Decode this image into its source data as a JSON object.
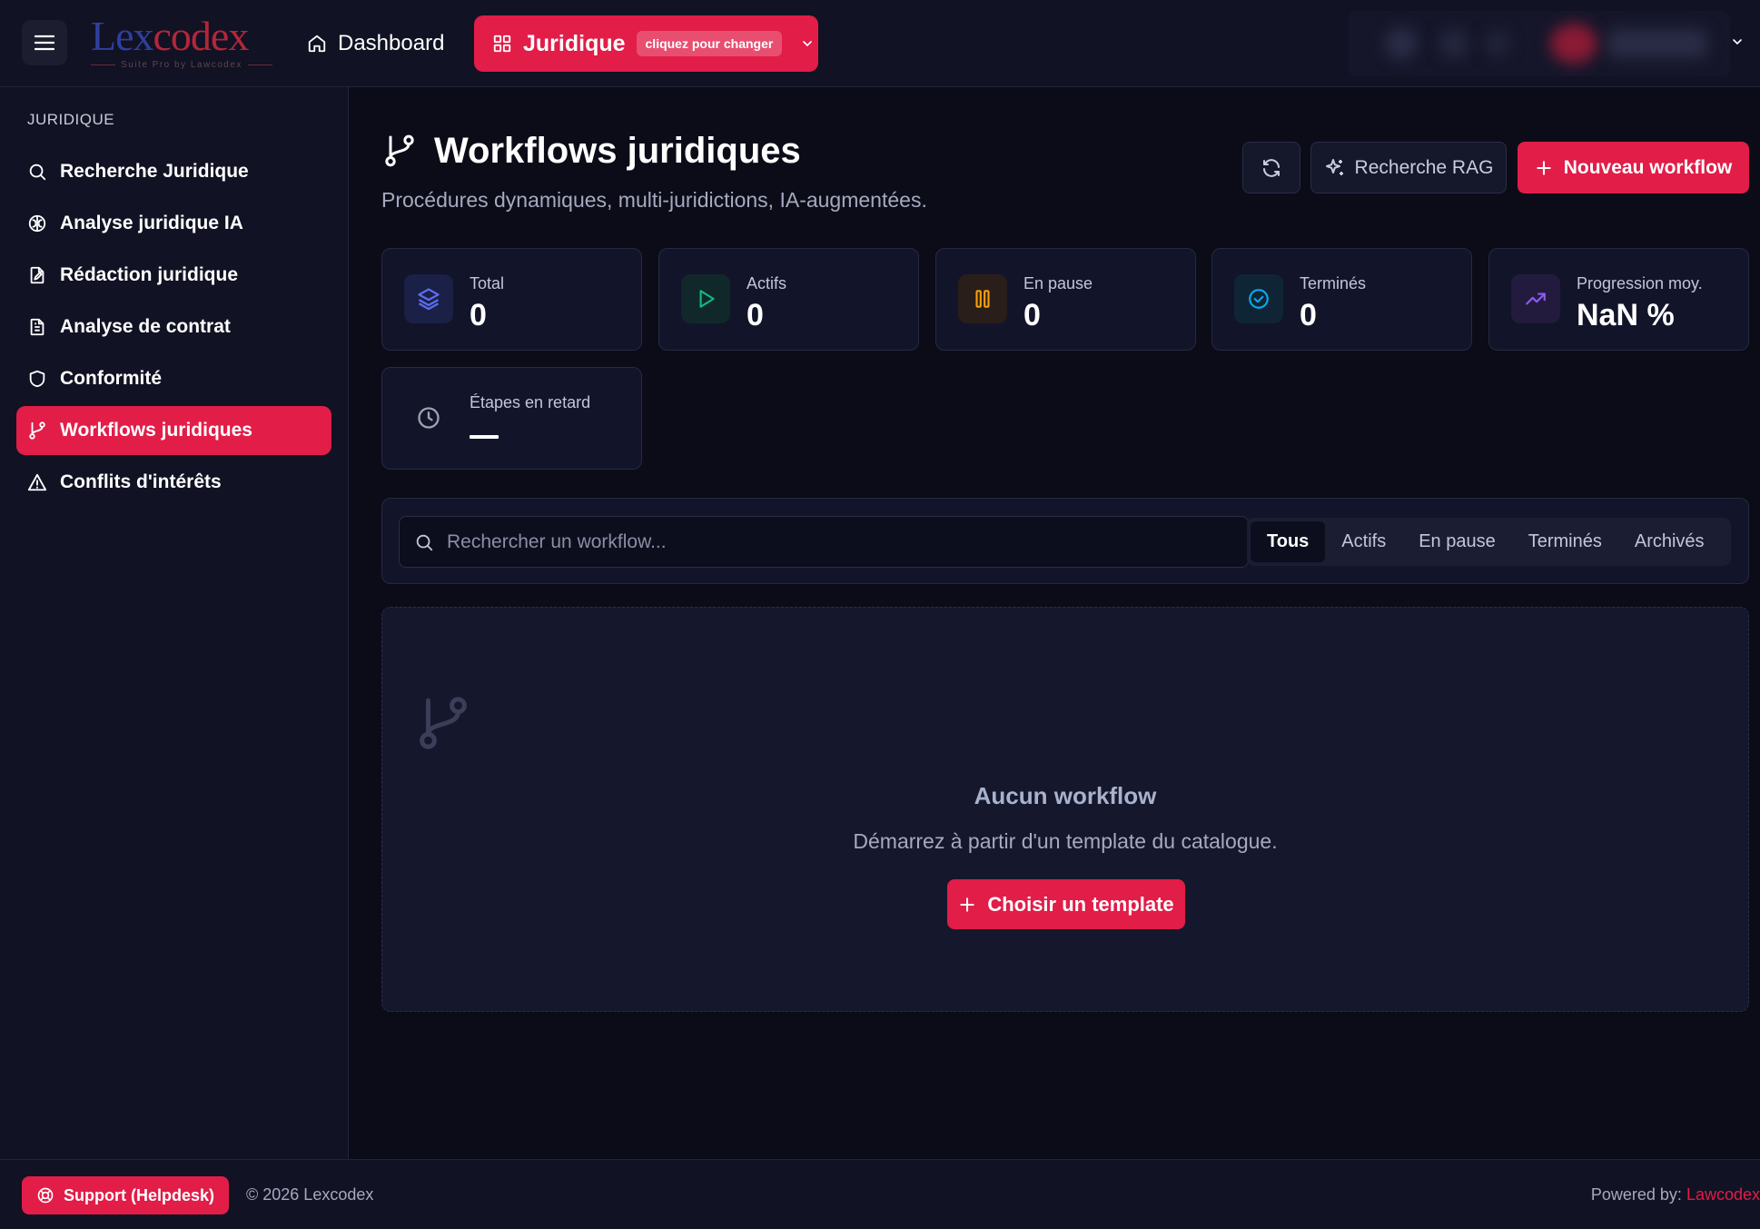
{
  "header": {
    "logo": {
      "part1": "Lex",
      "part2": "codex",
      "subtitle": "Suite Pro by Lawcodex"
    },
    "dashboard_label": "Dashboard",
    "module": {
      "name": "Juridique",
      "hint": "cliquez pour changer"
    }
  },
  "sidebar": {
    "section_title": "JURIDIQUE",
    "items": [
      {
        "label": "Recherche Juridique",
        "icon": "search-icon"
      },
      {
        "label": "Analyse juridique IA",
        "icon": "brain-icon"
      },
      {
        "label": "Rédaction juridique",
        "icon": "file-pen-icon"
      },
      {
        "label": "Analyse de contrat",
        "icon": "file-text-icon"
      },
      {
        "label": "Conformité",
        "icon": "shield-icon"
      },
      {
        "label": "Workflows juridiques",
        "icon": "git-branch-icon",
        "active": true
      },
      {
        "label": "Conflits d'intérêts",
        "icon": "alert-triangle-icon"
      }
    ]
  },
  "page": {
    "title": "Workflows juridiques",
    "subtitle": "Procédures dynamiques, multi-juridictions, IA-augmentées.",
    "actions": {
      "rag_label": "Recherche RAG",
      "new_label": "Nouveau workflow"
    }
  },
  "stats": [
    {
      "label": "Total",
      "value": "0",
      "icon": "layers-icon",
      "color": "#5b6cf0"
    },
    {
      "label": "Actifs",
      "value": "0",
      "icon": "play-icon",
      "color": "#10b981"
    },
    {
      "label": "En pause",
      "value": "0",
      "icon": "pause-icon",
      "color": "#f59e0b"
    },
    {
      "label": "Terminés",
      "value": "0",
      "icon": "check-circle-icon",
      "color": "#0ea5e9"
    },
    {
      "label": "Progression moy.",
      "value": "NaN %",
      "icon": "trending-up-icon",
      "color": "#8b5cf6"
    },
    {
      "label": "Étapes en retard",
      "value": "",
      "icon": "clock-icon",
      "color": "#9ca3af"
    }
  ],
  "filters": {
    "search_placeholder": "Rechercher un workflow...",
    "tabs": [
      "Tous",
      "Actifs",
      "En pause",
      "Terminés",
      "Archivés"
    ],
    "active_tab": "Tous"
  },
  "empty_state": {
    "title": "Aucun workflow",
    "text": "Démarrez à partir d'un template du catalogue.",
    "button_label": "Choisir un template"
  },
  "footer": {
    "support_label": "Support (Helpdesk)",
    "copyright": "© 2026 Lexcodex",
    "powered_prefix": "Powered by: ",
    "powered_brand": "Lawcodex"
  },
  "colors": {
    "accent": "#e11d48",
    "background": "#0b0c18",
    "surface": "#12142a"
  }
}
